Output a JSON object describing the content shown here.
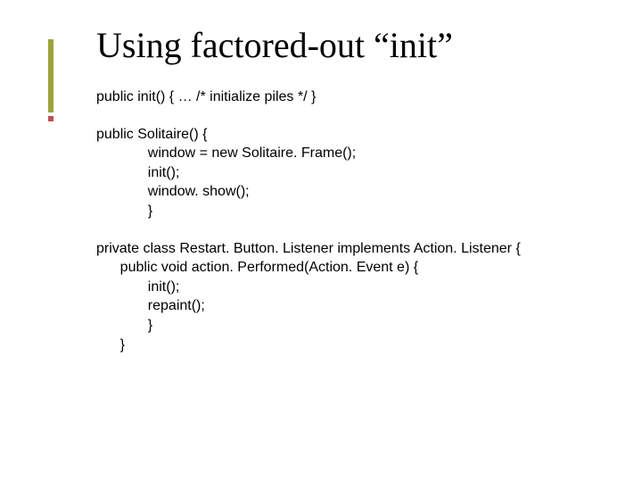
{
  "title": "Using factored-out “init”",
  "code": {
    "block1": "public init() { … /* initialize piles */ }",
    "block2": "public Solitaire() {\n             window = new Solitaire. Frame();\n             init();\n             window. show();\n             }",
    "block3": "private class Restart. Button. Listener implements Action. Listener {\n      public void action. Performed(Action. Event e) {\n             init();\n             repaint();\n             }\n      }"
  }
}
